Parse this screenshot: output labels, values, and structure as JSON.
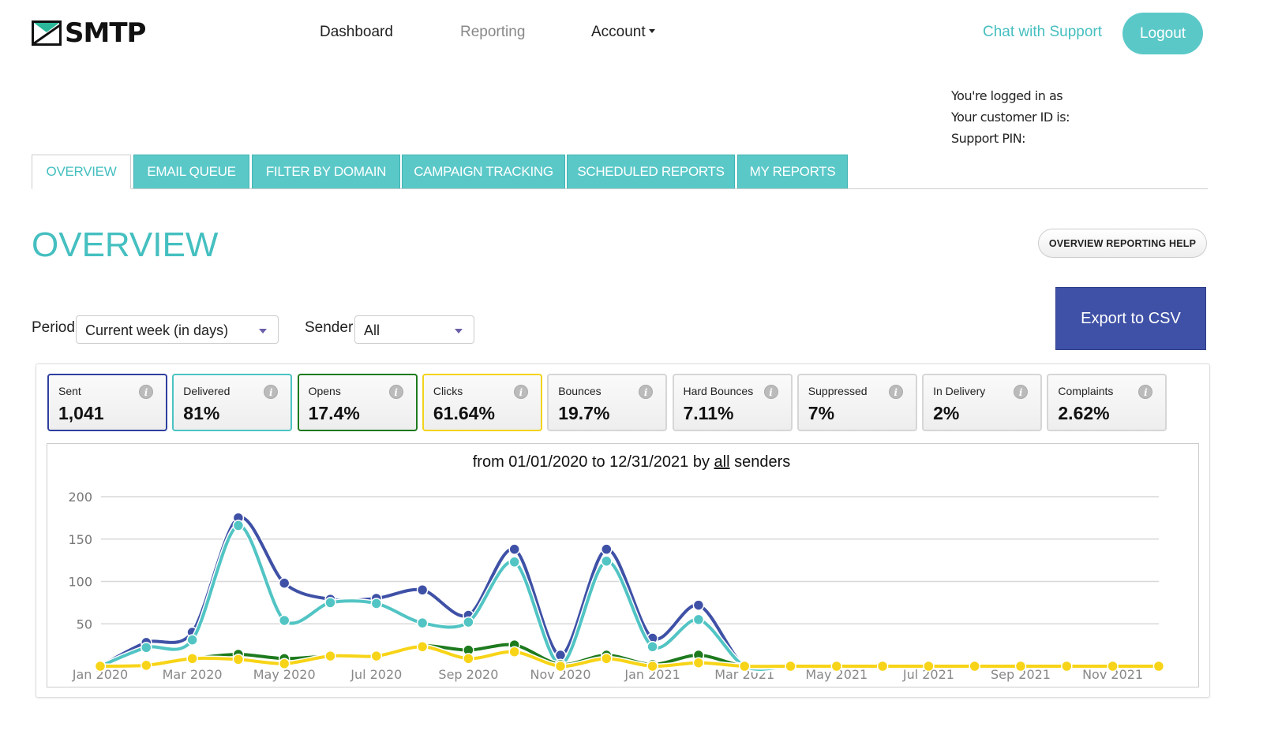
{
  "brand": {
    "name": "SMTP",
    "accent": "#45bfc0",
    "flap_color": "#2bb89a"
  },
  "nav": {
    "dashboard": "Dashboard",
    "reporting": "Reporting",
    "account": "Account"
  },
  "header": {
    "chat_support": "Chat with Support",
    "logout": "Logout"
  },
  "user_info": {
    "logged_in_as": "You're logged in as",
    "customer_id": "Your customer ID is:",
    "support_pin": "Support PIN:"
  },
  "tabs": [
    {
      "label": "OVERVIEW",
      "active": true
    },
    {
      "label": "EMAIL QUEUE"
    },
    {
      "label": "FILTER BY DOMAIN"
    },
    {
      "label": "CAMPAIGN TRACKING"
    },
    {
      "label": "SCHEDULED REPORTS"
    },
    {
      "label": "MY REPORTS"
    }
  ],
  "page_title": "OVERVIEW",
  "help_button": "OVERVIEW REPORTING HELP",
  "export_button": "Export to CSV",
  "filters": {
    "period_label": "Period",
    "period_value": "Current week (in days)",
    "sender_label": "Sender",
    "sender_value": "All"
  },
  "stats": [
    {
      "label": "Sent",
      "value": "1,041",
      "border": "#2e3f9e"
    },
    {
      "label": "Delivered",
      "value": "81%",
      "border": "#4cc3c3"
    },
    {
      "label": "Opens",
      "value": "17.4%",
      "border": "#1d7a1d"
    },
    {
      "label": "Clicks",
      "value": "61.64%",
      "border": "#f2d31b"
    },
    {
      "label": "Bounces",
      "value": "19.7%"
    },
    {
      "label": "Hard Bounces",
      "value": "7.11%"
    },
    {
      "label": "Suppressed",
      "value": "7%"
    },
    {
      "label": "In Delivery",
      "value": "2%"
    },
    {
      "label": "Complaints",
      "value": "2.62%"
    }
  ],
  "info_icon_glyph": "i",
  "chart_title": {
    "prefix": "from 01/01/2020 to 12/31/2021 by ",
    "link": "all",
    "suffix": " senders"
  },
  "chart_data": {
    "type": "line",
    "title": "from 01/01/2020 to 12/31/2021 by all senders",
    "xlabel": "",
    "ylabel": "",
    "ylim": [
      0,
      200
    ],
    "yticks": [
      50,
      100,
      150,
      200
    ],
    "grid": true,
    "x": [
      "Jan 2020",
      "Feb 2020",
      "Mar 2020",
      "Apr 2020",
      "May 2020",
      "Jun 2020",
      "Jul 2020",
      "Aug 2020",
      "Sep 2020",
      "Oct 2020",
      "Nov 2020",
      "Dec 2020",
      "Jan 2021",
      "Feb 2021",
      "Mar 2021",
      "Apr 2021",
      "May 2021",
      "Jun 2021",
      "Jul 2021",
      "Aug 2021",
      "Sep 2021",
      "Oct 2021",
      "Nov 2021",
      "Dec 2021"
    ],
    "xtick_labels": [
      "Jan 2020",
      "Mar 2020",
      "May 2020",
      "Jul 2020",
      "Sep 2020",
      "Nov 2020",
      "Jan 2021",
      "Mar 2021",
      "May 2021",
      "Jul 2021",
      "Sep 2021",
      "Nov 2021"
    ],
    "series": [
      {
        "name": "Sent",
        "color": "#3f51a6",
        "values": [
          0,
          28,
          40,
          175,
          98,
          79,
          80,
          90,
          60,
          138,
          13,
          138,
          33,
          72,
          0,
          0,
          0,
          0,
          0,
          0,
          0,
          0,
          0,
          0
        ]
      },
      {
        "name": "Delivered",
        "color": "#52c4c4",
        "values": [
          0,
          22,
          31,
          166,
          54,
          75,
          74,
          51,
          52,
          123,
          2,
          124,
          23,
          55,
          0,
          0,
          0,
          0,
          0,
          0,
          0,
          0,
          0,
          0
        ]
      },
      {
        "name": "Opens",
        "color": "#1d7a1d",
        "values": [
          0,
          1,
          9,
          14,
          9,
          12,
          12,
          24,
          19,
          25,
          2,
          13,
          2,
          13,
          0,
          0,
          0,
          0,
          0,
          0,
          0,
          0,
          0,
          0
        ]
      },
      {
        "name": "Clicks",
        "color": "#f7d417",
        "values": [
          0,
          1,
          9,
          8,
          3,
          12,
          12,
          23,
          9,
          17,
          0,
          9,
          0,
          4,
          0,
          0,
          0,
          0,
          0,
          0,
          0,
          0,
          0,
          0
        ]
      }
    ]
  }
}
